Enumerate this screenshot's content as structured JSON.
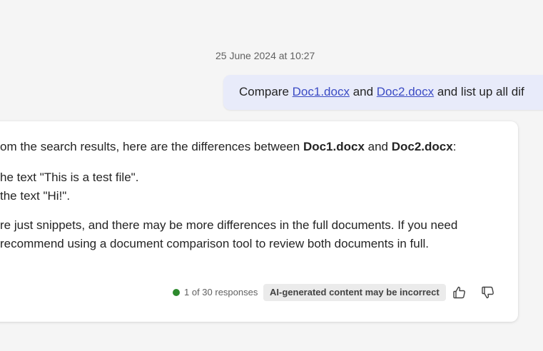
{
  "timestamp": "25 June 2024 at 10:27",
  "user_message": {
    "prefix": "Compare ",
    "link1": "Doc1.docx",
    "middle": " and ",
    "link2": "Doc2.docx",
    "suffix": " and list up all dif"
  },
  "ai_response": {
    "line1_prefix": "om the search results, here are the differences between ",
    "line1_bold1": "Doc1.docx",
    "line1_mid": " and ",
    "line1_bold2": "Doc2.docx",
    "line1_suffix": ":",
    "line2": "he text \"This is a test file\".",
    "line3": "the text \"Hi!\".",
    "line4": "re just snippets, and there may be more differences in the full documents. If you need",
    "line5": " recommend using a document comparison tool to review both documents in full."
  },
  "footer": {
    "responses": "1 of 30 responses",
    "badge": "AI-generated content may be incorrect",
    "status_color": "#2d8a2d"
  },
  "icons": {
    "like": "thumbs-up-icon",
    "dislike": "thumbs-down-icon"
  }
}
